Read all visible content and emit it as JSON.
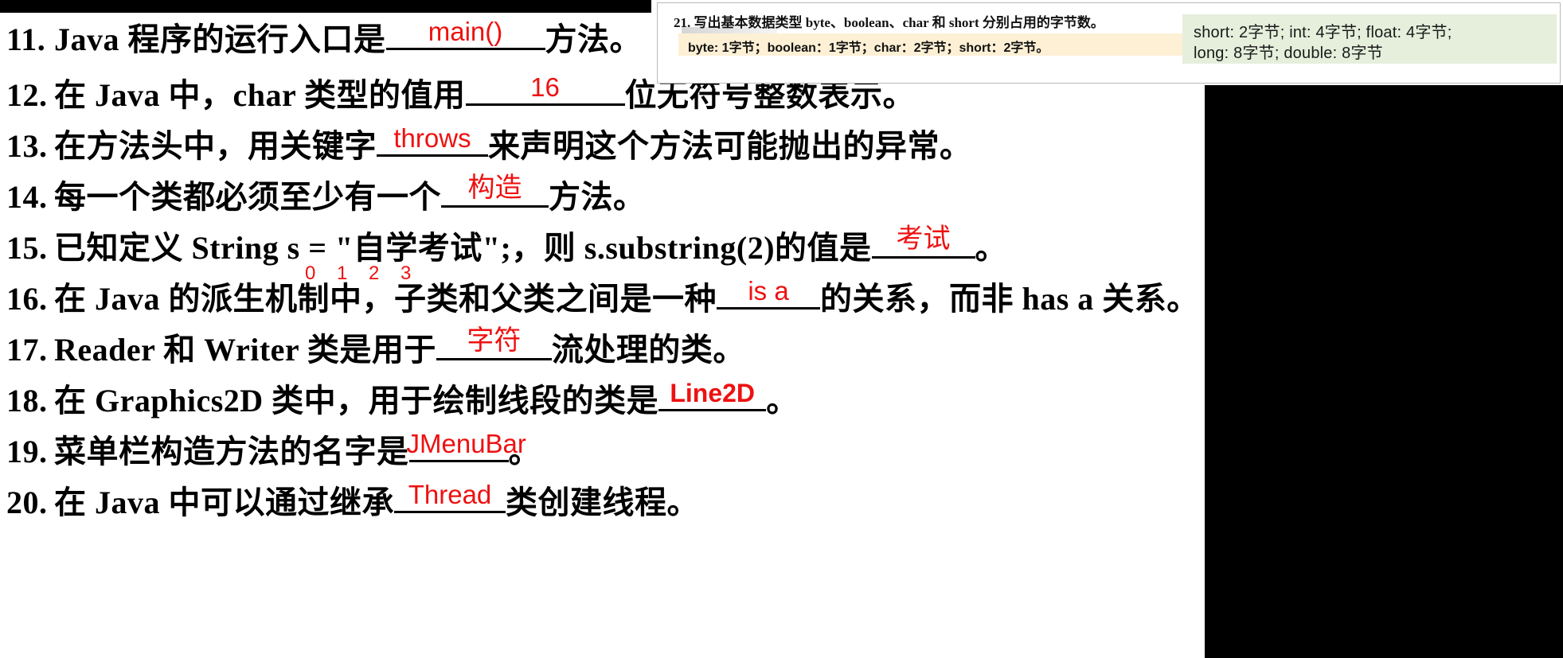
{
  "document": {
    "kind": "scanned-worksheet",
    "language": "zh-CN"
  },
  "colors": {
    "answer_red": "#ee1111",
    "green_card_bg": "#e5efdc",
    "beige_band_bg": "#fdf0d5",
    "black_panel": "#000000",
    "page_bg": "#ffffff"
  },
  "inset_panel": {
    "question_number": "21.",
    "question_text": "21. 写出基本数据类型 byte、boolean、char 和 short 分别占用的字节数。",
    "answer_band": "byte: 1字节；boolean：1字节；char：2字节；short：2字节。"
  },
  "green_card": {
    "line1": "short:  2字节;  int:  4字节;  float:  4字节;",
    "line2": "long:  8字节;  double:  8字节"
  },
  "questions": [
    {
      "number": "11.",
      "pre": "Java 程序的运行入口是",
      "answer": "main()",
      "post": "方法。"
    },
    {
      "number": "12.",
      "pre": "在 Java 中，char 类型的值用",
      "answer": "16",
      "post": "位无符号整数表示。"
    },
    {
      "number": "13.",
      "pre": "在方法头中，用关键字",
      "answer": "throws",
      "post": "来声明这个方法可能抛出的异常。"
    },
    {
      "number": "14.",
      "pre": "每一个类都必须至少有一个",
      "answer": "构造",
      "post": "方法。"
    },
    {
      "number": "15.",
      "pre": "已知定义 String s = \"自学考试\";，则 s.substring(2)的值是",
      "answer": "考试",
      "post": "。",
      "index_annotations": [
        "0",
        "1",
        "2",
        "3"
      ]
    },
    {
      "number": "16.",
      "pre": "在 Java 的派生机制中，子类和父类之间是一种",
      "answer": "is a",
      "post": "的关系，而非 has a 关系。"
    },
    {
      "number": "17.",
      "pre": "Reader 和 Writer 类是用于",
      "answer": "字符",
      "post": "流处理的类。"
    },
    {
      "number": "18.",
      "pre": "在 Graphics2D 类中，用于绘制线段的类是",
      "answer": "Line2D",
      "post": "。"
    },
    {
      "number": "19.",
      "pre": "菜单栏构造方法的名字是",
      "answer": "JMenuBar",
      "post": "。"
    },
    {
      "number": "20.",
      "pre": "在 Java 中可以通过继承",
      "answer": "Thread",
      "post": "类创建线程。"
    }
  ]
}
